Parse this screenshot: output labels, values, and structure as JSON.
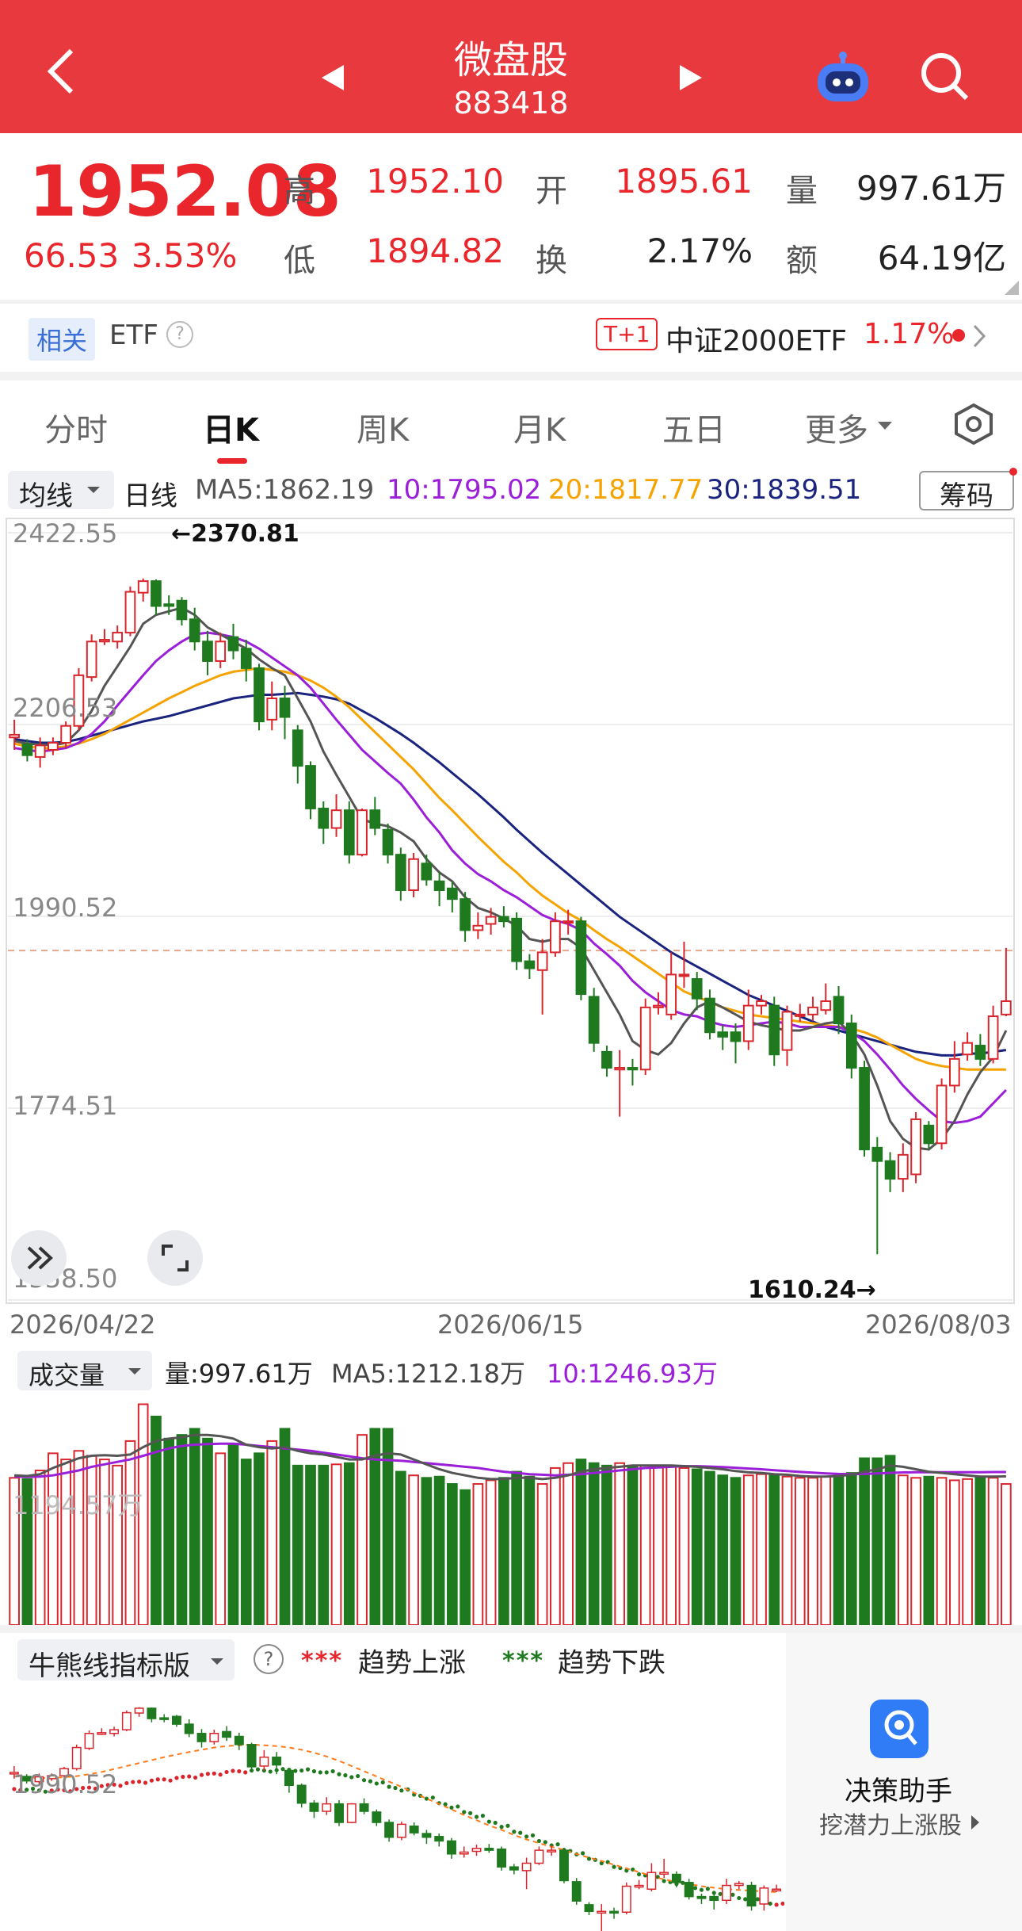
{
  "header": {
    "title": "微盘股",
    "code": "883418"
  },
  "quote": {
    "price": "1952.08",
    "change": "66.53",
    "change_pct": "3.53%",
    "labels": {
      "high": "高",
      "low": "低",
      "open": "开",
      "turnover": "换",
      "volume": "量",
      "amount": "额"
    },
    "high": "1952.10",
    "low": "1894.82",
    "open": "1895.61",
    "turnover": "2.17%",
    "volume": "997.61万",
    "amount": "64.19亿"
  },
  "related": {
    "tag": "相关",
    "etf_label": "ETF",
    "t1_badge": "T+1",
    "etf_name": "中证2000ETF",
    "etf_change": "1.17%"
  },
  "tabs": [
    "分时",
    "日K",
    "周K",
    "月K",
    "五日",
    "更多"
  ],
  "active_tab": 1,
  "ma_row": {
    "selector": "均线",
    "period": "日线",
    "ma5": "MA5:1862.19",
    "ma10": "10:1795.02",
    "ma20": "20:1817.77",
    "ma30": "30:1839.51",
    "chip_button": "筹码"
  },
  "colors": {
    "up": "#d9262d",
    "down": "#1f7a1f",
    "ma5": "#555555",
    "ma10": "#9b1fd8",
    "ma20": "#f5a300",
    "ma30": "#1a237e",
    "header": "#e8393f"
  },
  "chart_data": {
    "type": "candlestick",
    "y_ticks": [
      "2422.55",
      "2206.53",
      "1990.52",
      "1774.51",
      "1558.50"
    ],
    "ylim": [
      1558.5,
      2422.55
    ],
    "x_ticks": [
      "2026/04/22",
      "2026/06/15",
      "2026/08/03"
    ],
    "max_label": "←2370.81",
    "min_label": "1610.24→",
    "last_close": 1952.08,
    "candles": [
      [
        2192,
        2195,
        2212,
        2178
      ],
      [
        2184,
        2172,
        2190,
        2165
      ],
      [
        2170,
        2183,
        2192,
        2158
      ],
      [
        2178,
        2186,
        2192,
        2172
      ],
      [
        2186,
        2205,
        2210,
        2180
      ],
      [
        2205,
        2262,
        2270,
        2200
      ],
      [
        2260,
        2300,
        2308,
        2255
      ],
      [
        2300,
        2302,
        2314,
        2296
      ],
      [
        2300,
        2310,
        2318,
        2292
      ],
      [
        2310,
        2356,
        2362,
        2306
      ],
      [
        2355,
        2368,
        2371,
        2345
      ],
      [
        2368,
        2340,
        2370,
        2330
      ],
      [
        2342,
        2340,
        2352,
        2330
      ],
      [
        2346,
        2325,
        2350,
        2318
      ],
      [
        2325,
        2300,
        2338,
        2290
      ],
      [
        2300,
        2278,
        2312,
        2262
      ],
      [
        2278,
        2300,
        2310,
        2270
      ],
      [
        2305,
        2290,
        2320,
        2280
      ],
      [
        2292,
        2270,
        2302,
        2255
      ],
      [
        2270,
        2210,
        2275,
        2200
      ],
      [
        2212,
        2236,
        2255,
        2200
      ],
      [
        2236,
        2215,
        2250,
        2190
      ],
      [
        2200,
        2160,
        2206,
        2140
      ],
      [
        2160,
        2112,
        2165,
        2100
      ],
      [
        2112,
        2090,
        2120,
        2072
      ],
      [
        2090,
        2110,
        2128,
        2080
      ],
      [
        2110,
        2060,
        2120,
        2050
      ],
      [
        2060,
        2110,
        2112,
        2058
      ],
      [
        2110,
        2090,
        2125,
        2082
      ],
      [
        2088,
        2060,
        2095,
        2050
      ],
      [
        2060,
        2020,
        2068,
        2008
      ],
      [
        2020,
        2055,
        2062,
        2012
      ],
      [
        2050,
        2032,
        2060,
        2025
      ],
      [
        2030,
        2020,
        2040,
        2002
      ],
      [
        2022,
        2010,
        2030,
        1995
      ],
      [
        2010,
        1975,
        2018,
        1962
      ],
      [
        1975,
        1980,
        1995,
        1965
      ],
      [
        1982,
        1990,
        2000,
        1970
      ],
      [
        1990,
        1985,
        2002,
        1978
      ],
      [
        1988,
        1940,
        1995,
        1930
      ],
      [
        1940,
        1932,
        1948,
        1920
      ],
      [
        1930,
        1950,
        1965,
        1880
      ],
      [
        1950,
        1985,
        1995,
        1945
      ],
      [
        1985,
        1985,
        1998,
        1970
      ],
      [
        1985,
        1903,
        1990,
        1896
      ],
      [
        1900,
        1848,
        1910,
        1838
      ],
      [
        1838,
        1820,
        1845,
        1810
      ],
      [
        1818,
        1820,
        1840,
        1765
      ],
      [
        1820,
        1818,
        1830,
        1800
      ],
      [
        1818,
        1888,
        1898,
        1812
      ],
      [
        1888,
        1890,
        1905,
        1880
      ],
      [
        1880,
        1925,
        1950,
        1874
      ],
      [
        1925,
        1925,
        1962,
        1910
      ],
      [
        1920,
        1898,
        1928,
        1885
      ],
      [
        1898,
        1860,
        1908,
        1852
      ],
      [
        1860,
        1855,
        1868,
        1840
      ],
      [
        1860,
        1850,
        1870,
        1825
      ],
      [
        1850,
        1890,
        1908,
        1840
      ],
      [
        1890,
        1895,
        1902,
        1880
      ],
      [
        1890,
        1835,
        1900,
        1822
      ],
      [
        1840,
        1883,
        1890,
        1822
      ],
      [
        1880,
        1880,
        1892,
        1872
      ],
      [
        1880,
        1888,
        1900,
        1873
      ],
      [
        1885,
        1895,
        1915,
        1880
      ],
      [
        1900,
        1870,
        1912,
        1858
      ],
      [
        1870,
        1820,
        1880,
        1808
      ],
      [
        1820,
        1728,
        1828,
        1720
      ],
      [
        1730,
        1715,
        1742,
        1610
      ],
      [
        1715,
        1695,
        1725,
        1680
      ],
      [
        1695,
        1722,
        1735,
        1680
      ],
      [
        1700,
        1762,
        1770,
        1690
      ],
      [
        1755,
        1735,
        1760,
        1728
      ],
      [
        1735,
        1800,
        1808,
        1728
      ],
      [
        1800,
        1830,
        1850,
        1792
      ],
      [
        1835,
        1848,
        1860,
        1828
      ],
      [
        1845,
        1830,
        1858,
        1822
      ],
      [
        1830,
        1878,
        1890,
        1825
      ],
      [
        1880,
        1895,
        1955,
        1878
      ]
    ],
    "ma5": [
      2188,
      2185,
      2184,
      2183,
      2186,
      2200,
      2222,
      2250,
      2272,
      2294,
      2320,
      2330,
      2334,
      2338,
      2330,
      2316,
      2308,
      2300,
      2292,
      2280,
      2270,
      2262,
      2236,
      2210,
      2176,
      2150,
      2125,
      2100,
      2095,
      2092,
      2085,
      2075,
      2055,
      2040,
      2030,
      2012,
      2000,
      1995,
      1988,
      1980,
      1965,
      1962,
      1965,
      1965,
      1955,
      1930,
      1905,
      1880,
      1850,
      1840,
      1835,
      1848,
      1870,
      1888,
      1895,
      1888,
      1880,
      1872,
      1868,
      1865,
      1862,
      1862,
      1866,
      1870,
      1872,
      1858,
      1835,
      1800,
      1760,
      1740,
      1730,
      1728,
      1740,
      1760,
      1790,
      1815,
      1832,
      1862
    ],
    "ma10": [
      2180,
      2178,
      2176,
      2178,
      2180,
      2186,
      2196,
      2210,
      2228,
      2245,
      2262,
      2278,
      2290,
      2300,
      2308,
      2310,
      2308,
      2305,
      2300,
      2292,
      2282,
      2272,
      2262,
      2248,
      2230,
      2212,
      2195,
      2178,
      2165,
      2152,
      2140,
      2122,
      2102,
      2085,
      2065,
      2050,
      2038,
      2030,
      2020,
      2012,
      2002,
      1992,
      1986,
      1982,
      1975,
      1960,
      1948,
      1935,
      1918,
      1905,
      1895,
      1885,
      1880,
      1878,
      1872,
      1868,
      1866,
      1868,
      1870,
      1872,
      1870,
      1866,
      1866,
      1866,
      1866,
      1860,
      1850,
      1835,
      1818,
      1800,
      1785,
      1772,
      1760,
      1758,
      1760,
      1765,
      1780,
      1795
    ],
    "ma20": [
      2185,
      2182,
      2180,
      2180,
      2182,
      2185,
      2190,
      2196,
      2204,
      2212,
      2220,
      2228,
      2236,
      2243,
      2250,
      2256,
      2262,
      2266,
      2268,
      2270,
      2268,
      2266,
      2262,
      2256,
      2248,
      2238,
      2226,
      2212,
      2198,
      2184,
      2170,
      2156,
      2140,
      2124,
      2110,
      2095,
      2080,
      2066,
      2052,
      2040,
      2026,
      2014,
      2004,
      1994,
      1986,
      1975,
      1965,
      1956,
      1946,
      1936,
      1926,
      1916,
      1906,
      1900,
      1894,
      1888,
      1884,
      1880,
      1878,
      1876,
      1874,
      1872,
      1870,
      1868,
      1866,
      1864,
      1860,
      1854,
      1846,
      1838,
      1830,
      1825,
      1822,
      1820,
      1818,
      1818,
      1818,
      1818
    ],
    "ma30": [
      2190,
      2188,
      2186,
      2186,
      2187,
      2190,
      2194,
      2198,
      2202,
      2206,
      2210,
      2213,
      2216,
      2220,
      2224,
      2228,
      2232,
      2236,
      2238,
      2240,
      2240,
      2241,
      2242,
      2240,
      2238,
      2235,
      2230,
      2222,
      2214,
      2205,
      2196,
      2186,
      2175,
      2164,
      2152,
      2140,
      2128,
      2115,
      2102,
      2088,
      2075,
      2062,
      2050,
      2038,
      2026,
      2014,
      2002,
      1990,
      1980,
      1970,
      1960,
      1950,
      1942,
      1934,
      1926,
      1918,
      1910,
      1902,
      1896,
      1890,
      1884,
      1878,
      1872,
      1866,
      1862,
      1858,
      1854,
      1850,
      1846,
      1842,
      1838,
      1836,
      1834,
      1834,
      1836,
      1836,
      1838,
      1840
    ]
  },
  "volume_panel": {
    "selector": "成交量",
    "vol": "量:997.61万",
    "ma5": "MA5:1212.18万",
    "ma10": "10:1246.93万",
    "y_label": "1194.57万"
  },
  "volume_data": {
    "values": [
      1200,
      1190,
      1260,
      1400,
      1350,
      1420,
      1380,
      1350,
      1300,
      1500,
      1800,
      1700,
      1520,
      1550,
      1600,
      1520,
      1400,
      1480,
      1350,
      1400,
      1500,
      1600,
      1300,
      1300,
      1300,
      1310,
      1320,
      1550,
      1600,
      1600,
      1250,
      1220,
      1200,
      1210,
      1150,
      1100,
      1150,
      1180,
      1200,
      1250,
      1210,
      1150,
      1280,
      1320,
      1350,
      1320,
      1300,
      1320,
      1300,
      1300,
      1300,
      1290,
      1280,
      1270,
      1250,
      1220,
      1200,
      1220,
      1230,
      1220,
      1210,
      1200,
      1200,
      1210,
      1220,
      1240,
      1360,
      1360,
      1380,
      1220,
      1200,
      1210,
      1200,
      1180,
      1190,
      1210,
      1200,
      1150
    ],
    "ma5": [
      1220,
      1215,
      1230,
      1280,
      1320,
      1360,
      1380,
      1385,
      1380,
      1390,
      1450,
      1500,
      1520,
      1530,
      1550,
      1550,
      1540,
      1520,
      1470,
      1450,
      1440,
      1450,
      1420,
      1400,
      1390,
      1370,
      1350,
      1350,
      1380,
      1400,
      1390,
      1350,
      1310,
      1270,
      1240,
      1220,
      1200,
      1190,
      1190,
      1200,
      1200,
      1190,
      1200,
      1220,
      1250,
      1270,
      1280,
      1290,
      1300,
      1300,
      1300,
      1300,
      1296,
      1290,
      1280,
      1270,
      1255,
      1245,
      1240,
      1230,
      1225,
      1215,
      1210,
      1210,
      1215,
      1225,
      1250,
      1270,
      1300,
      1290,
      1270,
      1250,
      1240,
      1230,
      1220,
      1210,
      1210,
      1212
    ],
    "ma10": [
      1210,
      1208,
      1210,
      1220,
      1240,
      1260,
      1290,
      1310,
      1330,
      1350,
      1380,
      1410,
      1440,
      1460,
      1470,
      1475,
      1478,
      1478,
      1470,
      1460,
      1450,
      1440,
      1430,
      1420,
      1405,
      1390,
      1375,
      1360,
      1350,
      1345,
      1340,
      1330,
      1320,
      1310,
      1300,
      1290,
      1280,
      1265,
      1250,
      1240,
      1230,
      1225,
      1220,
      1225,
      1230,
      1240,
      1250,
      1260,
      1270,
      1280,
      1285,
      1290,
      1295,
      1295,
      1292,
      1288,
      1282,
      1276,
      1270,
      1262,
      1255,
      1248,
      1242,
      1236,
      1232,
      1230,
      1232,
      1236,
      1240,
      1244,
      1246,
      1246,
      1246,
      1246,
      1246,
      1246,
      1247,
      1247
    ]
  },
  "bull_panel": {
    "selector": "牛熊线指标版",
    "help": "?",
    "legend_up": "趋势上涨",
    "legend_down": "趋势下跌",
    "y_label": "1990.52",
    "legend_up_marks": "***",
    "legend_down_marks": "***"
  },
  "assistant": {
    "title": "决策助手",
    "subtitle": "挖潜力上涨股"
  }
}
